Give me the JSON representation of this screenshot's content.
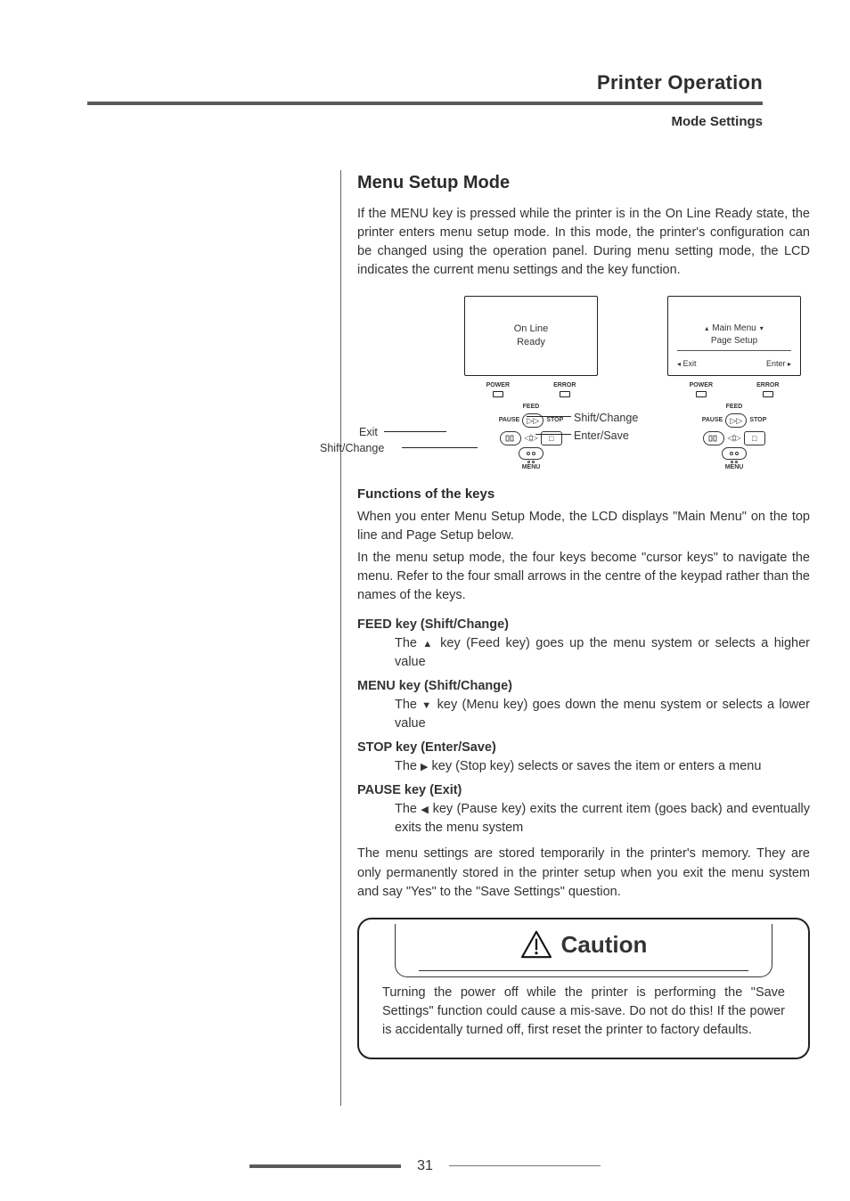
{
  "header": {
    "section_title": "Printer Operation",
    "subsection": "Mode Settings"
  },
  "h2": "Menu Setup Mode",
  "intro": "If the MENU key is pressed while the printer is in the On Line Ready state, the printer enters menu setup mode. In this mode, the printer's configuration can be changed using the operation panel.  During menu setting mode, the LCD indicates the current menu settings and the key function.",
  "diagram1": {
    "lcd_line1": "On Line",
    "lcd_line2": "Ready",
    "ind_power": "POWER",
    "ind_error": "ERROR",
    "feed": "FEED",
    "pause": "PAUSE",
    "stop": "STOP",
    "menu": "MENU",
    "callout_shift": "Shift/Change",
    "callout_enter": "Enter/Save",
    "callout_exit": "Exit",
    "callout_shift2": "Shift/Change"
  },
  "diagram2": {
    "lcd_line1": "Main Menu",
    "lcd_line2": "Page Setup",
    "exit": "Exit",
    "enter": "Enter",
    "ind_power": "POWER",
    "ind_error": "ERROR",
    "feed": "FEED",
    "pause": "PAUSE",
    "stop": "STOP",
    "menu": "MENU"
  },
  "functions_h3": "Functions of the keys",
  "functions_p1": "When you enter Menu Setup Mode, the LCD displays \"Main Menu\" on the top line and Page Setup below.",
  "functions_p2": "In the menu setup mode, the four keys become \"cursor keys\" to navigate the menu. Refer to the four small arrows in the centre of the keypad rather than the names of the keys.",
  "feed_title": "FEED key (Shift/Change)",
  "feed_desc_pre": "The ",
  "feed_desc_post": " key (Feed key) goes up the menu system or selects a higher value",
  "menu_title": "MENU key (Shift/Change)",
  "menu_desc_pre": "The ",
  "menu_desc_post": " key (Menu key) goes down the menu system or selects a lower value",
  "stop_title": "STOP key (Enter/Save)",
  "stop_desc_pre": "The ",
  "stop_desc_post": " key (Stop key) selects or saves the item or enters a menu",
  "pause_title": "PAUSE key (Exit)",
  "pause_desc_pre": "The ",
  "pause_desc_post": " key (Pause key) exits the current item (goes back) and eventually exits the menu system",
  "storage_para": "The menu settings are stored temporarily in the printer's memory. They are only permanently stored in the printer setup when you exit the menu system and say \"Yes\" to the \"Save Settings\" question.",
  "caution_label": "Caution",
  "caution_text": "Turning the power off while the printer is performing the \"Save Settings\" function could cause a mis-save. Do not do this!  If the power is accidentally turned off, first reset the printer to factory defaults.",
  "page_number": "31"
}
